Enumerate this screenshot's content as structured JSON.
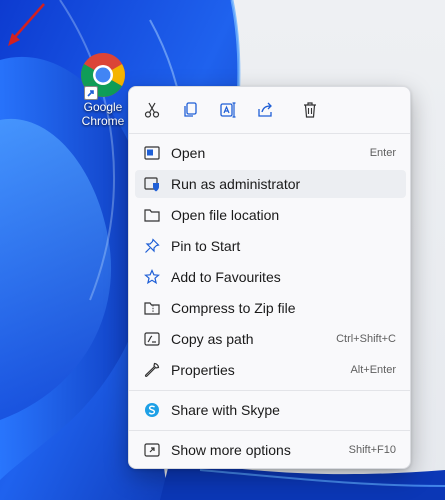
{
  "desktop": {
    "shortcut_label_line1": "Google",
    "shortcut_label_line2": "Chrome"
  },
  "toolbar": {
    "buttons": [
      {
        "icon": "cut-icon"
      },
      {
        "icon": "copy-icon"
      },
      {
        "icon": "rename-icon"
      },
      {
        "icon": "share-icon"
      },
      {
        "icon": "delete-icon"
      }
    ]
  },
  "menu": {
    "items": [
      {
        "label": "Open",
        "shortcut": "Enter",
        "icon": "open-icon"
      },
      {
        "label": "Run as administrator",
        "shortcut": "",
        "icon": "shield-icon"
      },
      {
        "label": "Open file location",
        "shortcut": "",
        "icon": "folder-icon"
      },
      {
        "label": "Pin to Start",
        "shortcut": "",
        "icon": "pin-icon"
      },
      {
        "label": "Add to Favourites",
        "shortcut": "",
        "icon": "star-icon"
      },
      {
        "label": "Compress to Zip file",
        "shortcut": "",
        "icon": "zip-folder-icon"
      },
      {
        "label": "Copy as path",
        "shortcut": "Ctrl+Shift+C",
        "icon": "copy-path-icon"
      },
      {
        "label": "Properties",
        "shortcut": "Alt+Enter",
        "icon": "wrench-icon"
      },
      {
        "label": "Share with Skype",
        "shortcut": "",
        "icon": "skype-icon"
      },
      {
        "label": "Show more options",
        "shortcut": "Shift+F10",
        "icon": "more-options-icon"
      }
    ]
  },
  "colors": {
    "wallpaper_blue": "#1a4fd8",
    "annotation_arrow": "#d32020",
    "shield_blue": "#1f5fd6",
    "skype_blue": "#1ea0e6"
  }
}
